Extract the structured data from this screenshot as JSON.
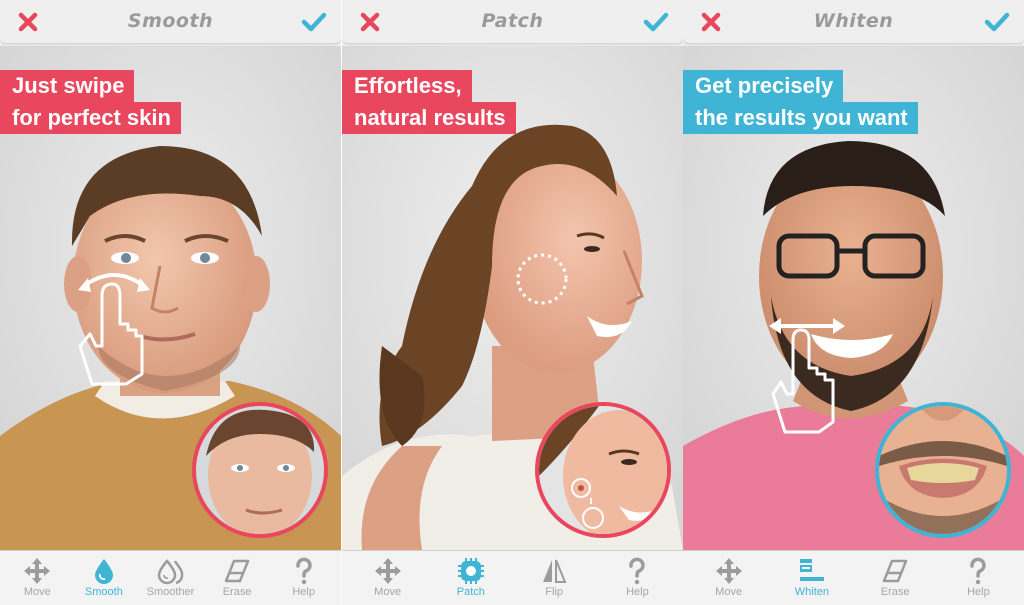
{
  "colors": {
    "accent_red": "#e9475d",
    "accent_blue": "#3fb4d4",
    "toolbar_bg": "#f3f3f3",
    "header_title": "#9a9a9a",
    "inactive_tool": "#a6a6a6"
  },
  "screens": [
    {
      "header": {
        "cancel_icon": "close-x-icon",
        "title": "Smooth",
        "confirm_icon": "checkmark-icon"
      },
      "headline": {
        "lines": [
          "Just swipe",
          "for perfect skin"
        ],
        "color": "#e9475d"
      },
      "overlay": {
        "gesture": "swipe-hand-with-double-arrow",
        "zoom_circle_border": "#e9475d"
      },
      "toolbar": [
        {
          "icon": "move-arrows-icon",
          "label": "Move",
          "active": false
        },
        {
          "icon": "water-drop-icon",
          "label": "Smooth",
          "active": true
        },
        {
          "icon": "double-drop-icon",
          "label": "Smoother",
          "active": false
        },
        {
          "icon": "eraser-icon",
          "label": "Erase",
          "active": false
        },
        {
          "icon": "question-mark-icon",
          "label": "Help",
          "active": false
        }
      ]
    },
    {
      "header": {
        "cancel_icon": "close-x-icon",
        "title": "Patch",
        "confirm_icon": "checkmark-icon"
      },
      "headline": {
        "lines": [
          "Effortless,",
          "natural results"
        ],
        "color": "#e9475d"
      },
      "overlay": {
        "gesture": "dotted-circle-selection",
        "zoom_circle_border": "#e9475d"
      },
      "toolbar": [
        {
          "icon": "move-arrows-icon",
          "label": "Move",
          "active": false
        },
        {
          "icon": "patch-icon",
          "label": "Patch",
          "active": true
        },
        {
          "icon": "flip-icon",
          "label": "Flip",
          "active": false
        },
        {
          "icon": "question-mark-icon",
          "label": "Help",
          "active": false
        }
      ]
    },
    {
      "header": {
        "cancel_icon": "close-x-icon",
        "title": "Whiten",
        "confirm_icon": "checkmark-icon"
      },
      "headline": {
        "lines": [
          "Get precisely",
          "the results you want"
        ],
        "color": "#3fb4d4"
      },
      "overlay": {
        "gesture": "swipe-hand-with-double-arrow",
        "zoom_circle_border": "#3fb4d4"
      },
      "toolbar": [
        {
          "icon": "move-arrows-icon",
          "label": "Move",
          "active": false
        },
        {
          "icon": "toothbrush-icon",
          "label": "Whiten",
          "active": true
        },
        {
          "icon": "eraser-icon",
          "label": "Erase",
          "active": false
        },
        {
          "icon": "question-mark-icon",
          "label": "Help",
          "active": false
        }
      ]
    }
  ]
}
